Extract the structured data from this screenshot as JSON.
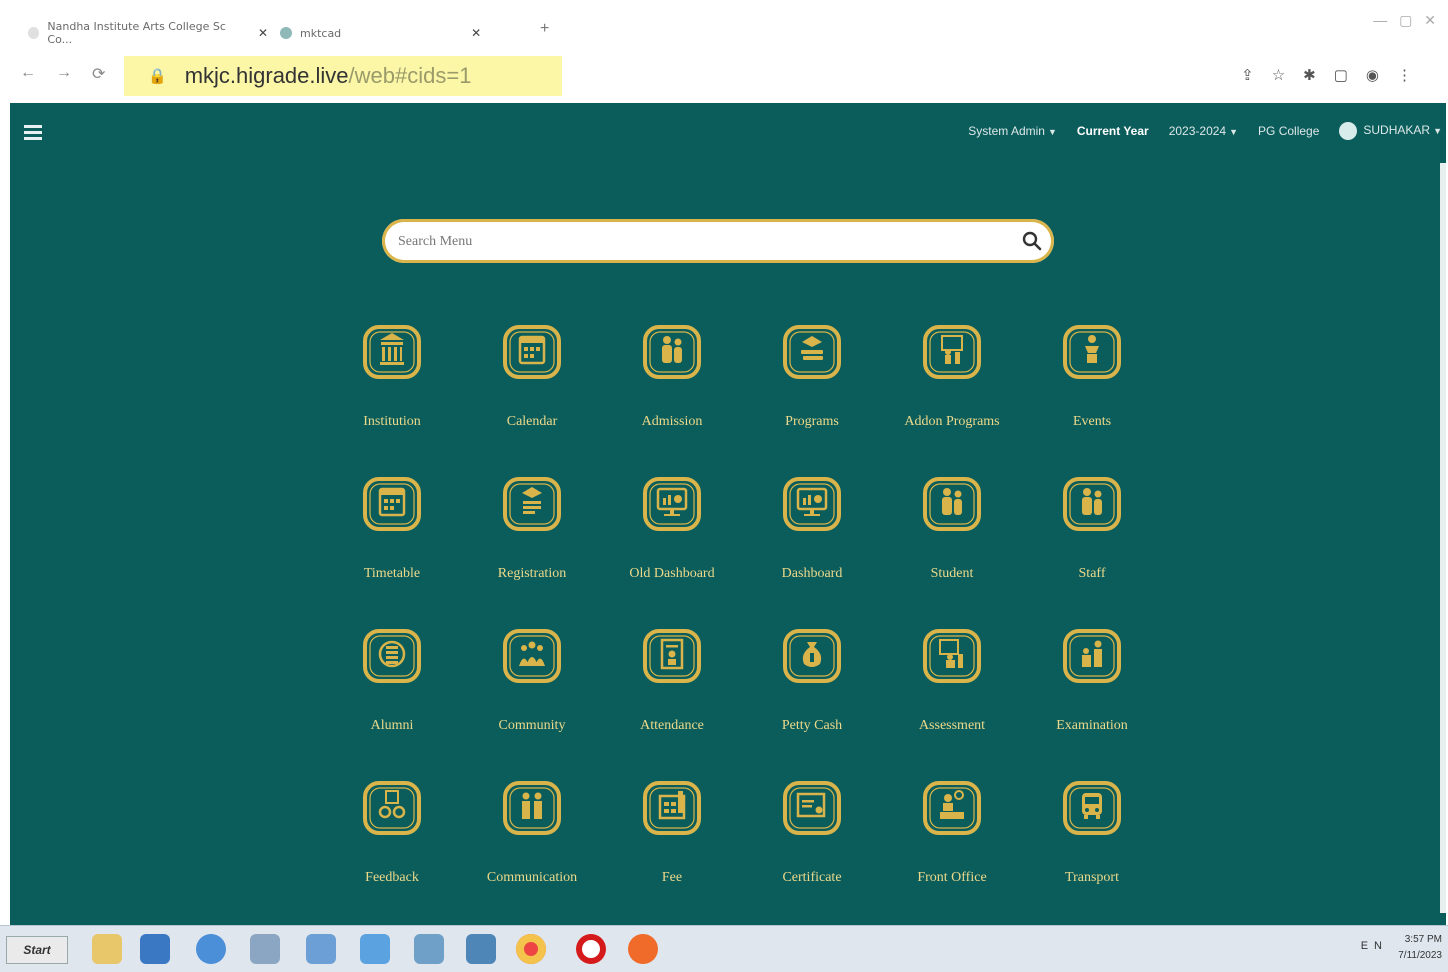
{
  "browser": {
    "tabs": [
      {
        "title": "Nandha Institute Arts College Sc Co..."
      },
      {
        "title": "mktcad"
      }
    ],
    "url_host": "mkjc.higrade.live",
    "url_path": "/web#cids=1"
  },
  "app": {
    "topbar": {
      "role": "System Admin",
      "current_year_label": "Current Year",
      "year_value": "2023-2024",
      "college": "PG College",
      "user": "SUDHAKAR"
    },
    "search": {
      "placeholder": "Search Menu"
    },
    "menu": [
      {
        "label": "Institution",
        "icon": "institution-icon"
      },
      {
        "label": "Calendar",
        "icon": "calendar-icon"
      },
      {
        "label": "Admission",
        "icon": "admission-icon"
      },
      {
        "label": "Programs",
        "icon": "programs-icon"
      },
      {
        "label": "Addon Programs",
        "icon": "addon-programs-icon"
      },
      {
        "label": "Events",
        "icon": "events-icon"
      },
      {
        "label": "Timetable",
        "icon": "timetable-icon"
      },
      {
        "label": "Registration",
        "icon": "registration-icon"
      },
      {
        "label": "Old Dashboard",
        "icon": "old-dashboard-icon"
      },
      {
        "label": "Dashboard",
        "icon": "dashboard-icon"
      },
      {
        "label": "Student",
        "icon": "student-icon"
      },
      {
        "label": "Staff",
        "icon": "staff-icon"
      },
      {
        "label": "Alumni",
        "icon": "alumni-icon"
      },
      {
        "label": "Community",
        "icon": "community-icon"
      },
      {
        "label": "Attendance",
        "icon": "attendance-icon"
      },
      {
        "label": "Petty Cash",
        "icon": "petty-cash-icon"
      },
      {
        "label": "Assessment",
        "icon": "assessment-icon"
      },
      {
        "label": "Examination",
        "icon": "examination-icon"
      },
      {
        "label": "Feedback",
        "icon": "feedback-icon"
      },
      {
        "label": "Communication",
        "icon": "communication-icon"
      },
      {
        "label": "Fee",
        "icon": "fee-icon"
      },
      {
        "label": "Certificate",
        "icon": "certificate-icon"
      },
      {
        "label": "Front Office",
        "icon": "front-office-icon"
      },
      {
        "label": "Transport",
        "icon": "transport-icon"
      }
    ]
  },
  "taskbar": {
    "start_label": "Start",
    "apps": [
      "explorer",
      "ie",
      "media",
      "recycle",
      "mail",
      "paint",
      "sound",
      "network",
      "chrome",
      "opera",
      "firefox"
    ],
    "tray": "EN",
    "time": "3:57 PM",
    "date": "7/11/2023"
  },
  "colors": {
    "app_bg": "#0b5d5c",
    "gold": "#d9b44a",
    "label": "#ecd98a",
    "url_highlight": "#fbf7a7"
  }
}
